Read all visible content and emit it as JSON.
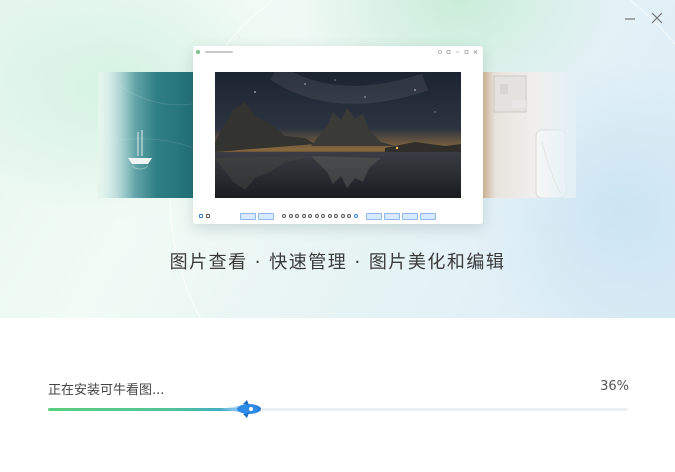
{
  "window": {
    "minimize_label": "minimize",
    "close_label": "close"
  },
  "tagline": {
    "text": "图片查看 · 快速管理 · 图片美化和编辑"
  },
  "install": {
    "status_text": "正在安装可牛看图...",
    "percent_text": "36%",
    "progress": 0.36
  },
  "colors": {
    "progress_start": "#5ccf7e",
    "progress_end": "#3aa0e0",
    "rocket": "#2f8be6"
  },
  "icons": [
    "minimize-icon",
    "close-icon",
    "rocket-icon"
  ]
}
